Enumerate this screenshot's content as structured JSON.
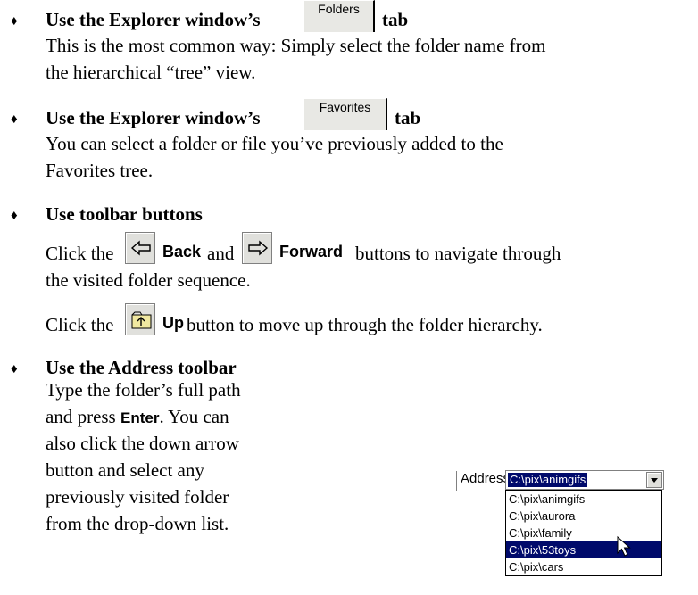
{
  "bullet_glyph": "♦",
  "sections": {
    "folders_tab": {
      "heading_pre": "Use the Explorer window’s",
      "tab_label": "Folders",
      "heading_post": "tab",
      "body": [
        "This is the most common way: Simply select the folder name from",
        "the hierarchical “tree” view."
      ]
    },
    "favorites_tab": {
      "heading_pre": "Use the Explorer window’s",
      "tab_label": "Favorites",
      "heading_post": "tab",
      "body": [
        "You can select a folder or file you’ve previously added to the",
        "Favorites tree."
      ]
    },
    "toolbar_buttons": {
      "heading": "Use toolbar buttons",
      "line1_pre": "Click the",
      "back_label": "Back",
      "line1_and": "and",
      "forward_label": "Forward",
      "line1_post": "buttons to navigate through",
      "line2": "the visited folder sequence.",
      "line3_pre": "Click the",
      "up_label": "Up",
      "line3_post": "button to move up through the folder hierarchy."
    },
    "address_toolbar": {
      "heading": "Use the Address toolbar",
      "body_line1": "Type the folder’s full path",
      "body_line2_pre": "and press",
      "enter_label": "Enter",
      "body_line2_post": ". You can",
      "body_lines": [
        "also click the down arrow",
        "button and select any",
        "previously visited folder",
        "from the drop-down list."
      ]
    }
  },
  "address_widget": {
    "label": "Address",
    "current_value": "C:\\pix\\animgifs",
    "dropdown_items": [
      "C:\\pix\\animgifs",
      "C:\\pix\\aurora",
      "C:\\pix\\family",
      "C:\\pix\\53toys",
      "C:\\pix\\cars"
    ],
    "highlighted_item": "C:\\pix\\53toys"
  }
}
